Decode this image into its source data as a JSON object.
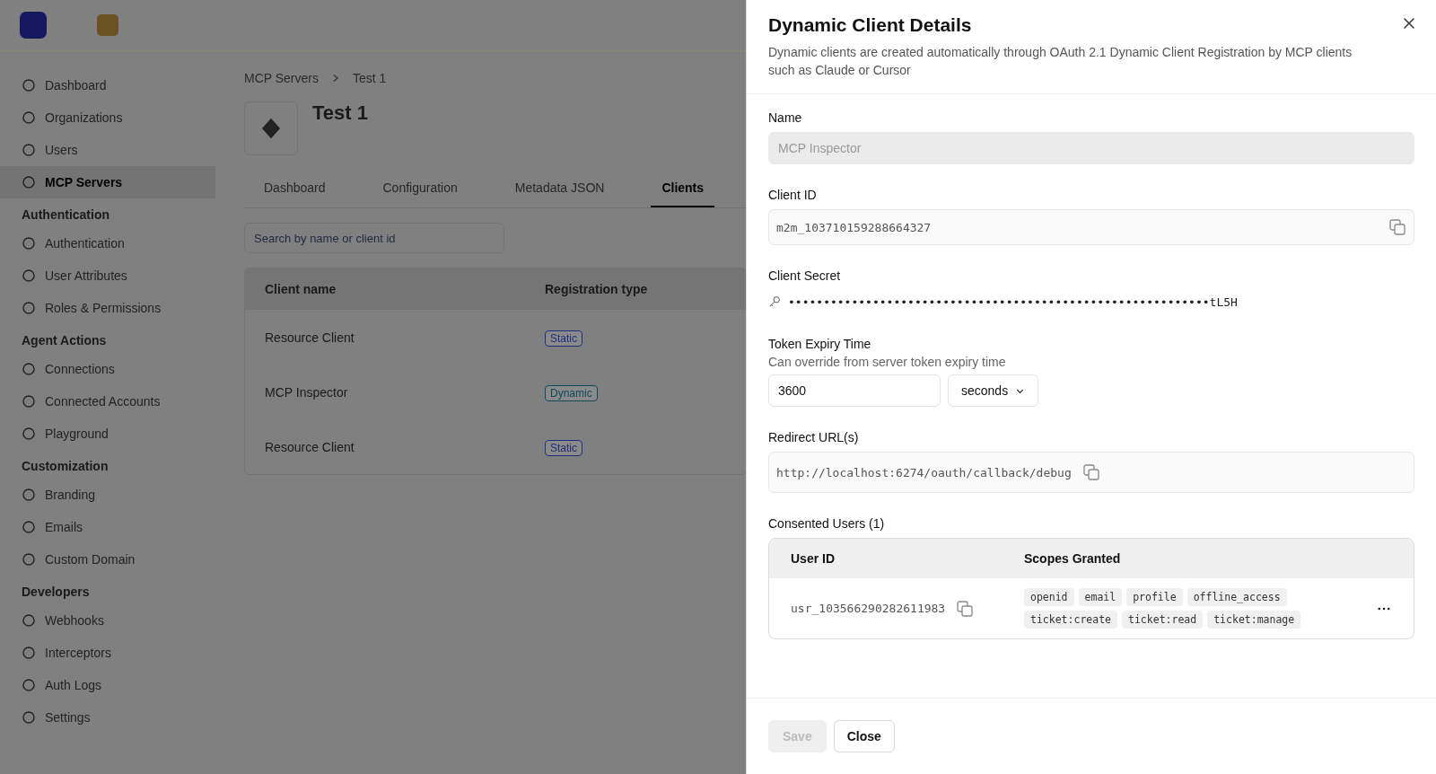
{
  "background": {
    "sidebar": {
      "sections": [
        {
          "items": [
            {
              "label": "Dashboard",
              "selected": false
            },
            {
              "label": "Organizations",
              "selected": false
            },
            {
              "label": "Users",
              "selected": false
            },
            {
              "label": "MCP Servers",
              "selected": true
            }
          ]
        },
        {
          "heading": "Authentication",
          "items": [
            {
              "label": "Authentication",
              "selected": false
            },
            {
              "label": "User Attributes",
              "selected": false
            },
            {
              "label": "Roles & Permissions",
              "selected": false
            }
          ]
        },
        {
          "heading": "Agent Actions",
          "items": [
            {
              "label": "Connections",
              "selected": false
            },
            {
              "label": "Connected Accounts",
              "selected": false
            },
            {
              "label": "Playground",
              "selected": false
            }
          ]
        },
        {
          "heading": "Customization",
          "items": [
            {
              "label": "Branding",
              "selected": false
            },
            {
              "label": "Emails",
              "selected": false
            },
            {
              "label": "Custom Domain",
              "selected": false
            }
          ]
        },
        {
          "heading": "Developers",
          "items": [
            {
              "label": "Webhooks",
              "selected": false
            },
            {
              "label": "Interceptors",
              "selected": false
            },
            {
              "label": "Auth Logs",
              "selected": false
            },
            {
              "label": "Settings",
              "selected": false
            }
          ]
        }
      ]
    },
    "breadcrumb": [
      "MCP Servers",
      "Test 1"
    ],
    "title": "Test 1",
    "tabs": [
      {
        "label": "Dashboard",
        "selected": false
      },
      {
        "label": "Configuration",
        "selected": false
      },
      {
        "label": "Metadata JSON",
        "selected": false
      },
      {
        "label": "Clients",
        "selected": true
      }
    ],
    "search": {
      "placeholder": "Search by name or client id"
    },
    "table": {
      "columns": [
        "Client name",
        "Registration type"
      ],
      "rows": [
        {
          "client_name": "Resource Client",
          "registration_type": "Static",
          "color": "#1f2f7a"
        },
        {
          "client_name": "MCP Inspector",
          "registration_type": "Dynamic",
          "color": "#104a5a"
        },
        {
          "client_name": "Resource Client",
          "registration_type": "Static",
          "color": "#1f2f7a"
        }
      ]
    }
  },
  "panel": {
    "title": "Dynamic Client Details",
    "description": "Dynamic clients are created automatically through OAuth 2.1 Dynamic Client Registration by MCP clients such as Claude or Cursor",
    "name": {
      "label": "Name",
      "value": "MCP Inspector",
      "disabled": true
    },
    "client_id": {
      "label": "Client ID",
      "value": "m2m_103710159288664327"
    },
    "client_secret": {
      "label": "Client Secret",
      "value": "••••••••••••••••••••••••••••••••••••••••••••••••••••••••••••tL5H"
    },
    "token_expiry": {
      "label": "Token Expiry Time",
      "hint": "Can override from server token expiry time",
      "value": "3600",
      "unit": "seconds"
    },
    "redirect_urls": {
      "label": "Redirect URL(s)",
      "values": [
        "http://localhost:6274/oauth/callback/debug"
      ]
    },
    "consented_users": {
      "label": "Consented Users (1)",
      "columns": [
        "User ID",
        "Scopes Granted"
      ],
      "rows": [
        {
          "user_id": "usr_103566290282611983",
          "scopes": [
            "openid",
            "email",
            "profile",
            "offline_access",
            "ticket:create",
            "ticket:read",
            "ticket:manage"
          ]
        }
      ]
    },
    "buttons": [
      {
        "label": "Save",
        "disabled": true
      },
      {
        "label": "Close",
        "disabled": false
      }
    ]
  }
}
